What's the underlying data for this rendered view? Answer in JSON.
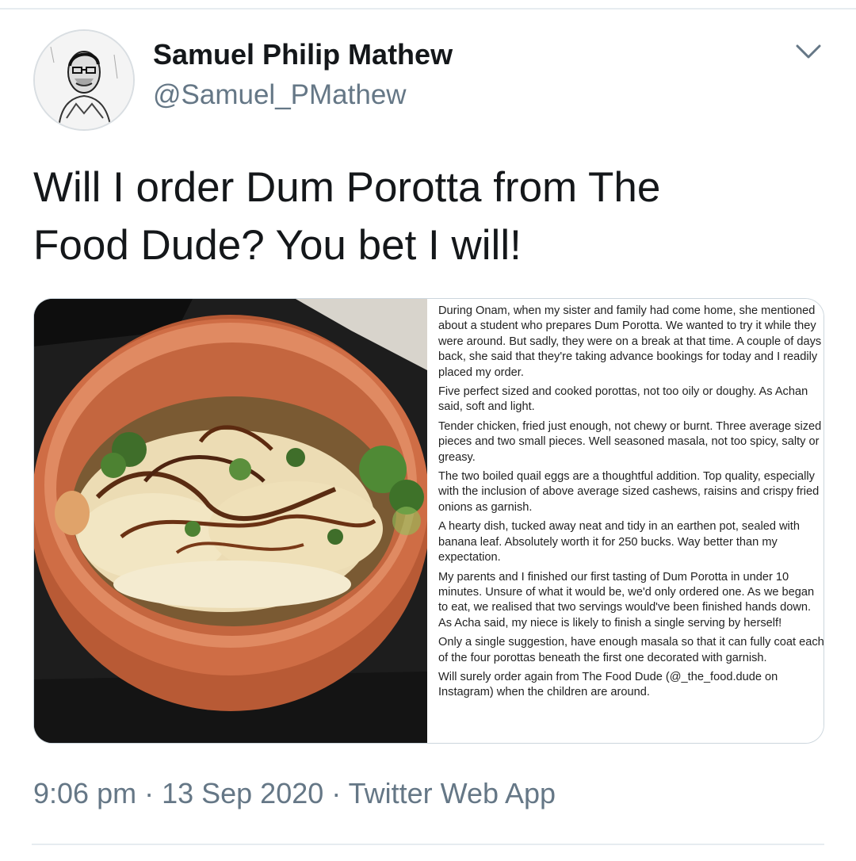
{
  "author": {
    "display_name": "Samuel Philip Mathew",
    "handle": "@Samuel_PMathew",
    "avatar_icon": "sketch-portrait-avatar"
  },
  "menu": {
    "icon": "chevron-down-icon"
  },
  "tweet": {
    "text_line1": "Will I order Dum Porotta from The",
    "text_line2": "Food Dude? You bet I will!"
  },
  "media": {
    "photo_description_icon": "clay-pot-food-photo",
    "review_paragraphs": [
      [
        "During Onam, when my sister and family had come home, she mentioned",
        "about a student who prepares Dum Porotta. We wanted to try it while they",
        "were around. But sadly, they were on a break at that time. A couple of days",
        "back, she said that they're taking advance bookings for today and I readily",
        "placed my order."
      ],
      [
        "Five perfect sized and cooked porottas, not too oily or doughy. As Achan",
        "said, soft and light."
      ],
      [
        "Tender chicken, fried just enough, not chewy or burnt. Three average sized",
        "pieces and two small pieces. Well seasoned masala, not too spicy, salty or",
        "greasy."
      ],
      [
        "The two boiled quail eggs are a thoughtful addition. Top quality, especially",
        "with the inclusion of above average sized cashews, raisins and crispy fried",
        "onions as garnish."
      ],
      [
        "A hearty dish, tucked away neat and tidy in an earthen pot, sealed with",
        "banana leaf. Absolutely worth it for 250 bucks. Way better than my",
        "expectation."
      ],
      [
        "My parents and I finished our first tasting of Dum Porotta in under 10",
        "minutes. Unsure of what it would be, we'd only ordered one. As we began",
        "to eat, we realised that two servings would've been finished hands down.",
        "As Acha said, my niece is likely to finish a single serving by herself!"
      ],
      [
        "Only a single suggestion, have enough masala so that it can fully coat each",
        "of the four porottas beneath the first one decorated with garnish."
      ],
      [
        "Will surely order again from The Food Dude (@_the_food.dude on",
        "Instagram) when the children are around."
      ]
    ]
  },
  "meta": {
    "time": "9:06 pm",
    "sep1": " · ",
    "date": "13 Sep 2020",
    "sep2": " · ",
    "source": "Twitter Web App"
  },
  "colors": {
    "text_primary": "#14171a",
    "text_secondary": "#657786",
    "divider": "#e6ecf0",
    "pot": "#c8683f"
  }
}
